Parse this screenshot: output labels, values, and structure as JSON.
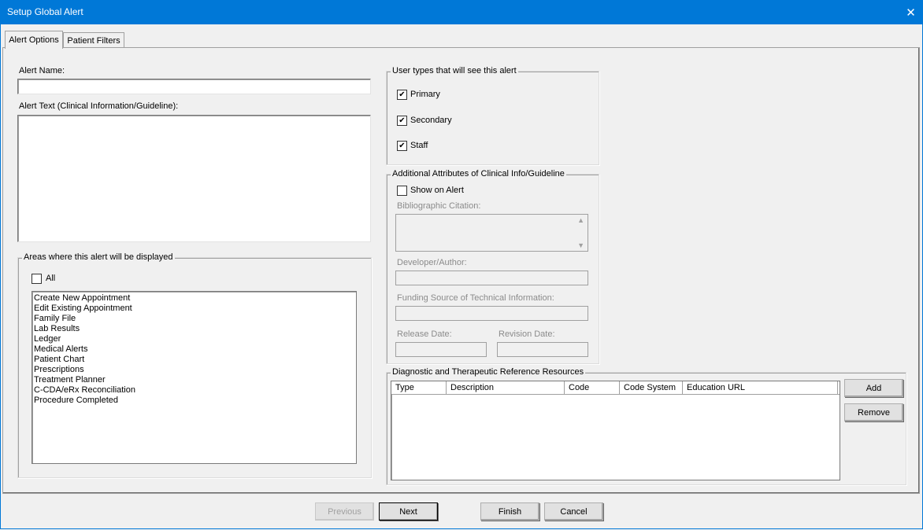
{
  "window": {
    "title": "Setup Global Alert",
    "close_glyph": "✕"
  },
  "tabs": [
    {
      "label": "Alert Options"
    },
    {
      "label": "Patient Filters"
    }
  ],
  "alert_name": {
    "label": "Alert Name:",
    "value": ""
  },
  "alert_text": {
    "label": "Alert Text (Clinical Information/Guideline):",
    "value": ""
  },
  "areas": {
    "caption": "Areas where this alert will be displayed",
    "all_label": "All",
    "all_checked": false,
    "items": [
      "Create New Appointment",
      "Edit Existing Appointment",
      "Family File",
      "Lab Results",
      "Ledger",
      "Medical Alerts",
      "Patient Chart",
      "Prescriptions",
      "Treatment Planner",
      "C-CDA/eRx Reconciliation",
      "Procedure Completed"
    ]
  },
  "user_types": {
    "caption": "User types that will see this alert",
    "options": [
      {
        "label": "Primary",
        "checked": true
      },
      {
        "label": "Secondary",
        "checked": true
      },
      {
        "label": "Staff",
        "checked": true
      }
    ],
    "check_glyph": "✔"
  },
  "attributes": {
    "caption": "Additional Attributes of Clinical Info/Guideline",
    "show_on_alert": "Show on Alert",
    "bibliographic": "Bibliographic Citation:",
    "developer": "Developer/Author:",
    "funding": "Funding Source of Technical Information:",
    "release_date": "Release Date:",
    "revision_date": "Revision Date:"
  },
  "resources": {
    "caption": "Diagnostic and Therapeutic Reference Resources",
    "columns": [
      "Type",
      "Description",
      "Code",
      "Code System",
      "Education URL"
    ],
    "add_label": "Add",
    "remove_label": "Remove"
  },
  "footer": {
    "previous": "Previous",
    "next": "Next",
    "finish": "Finish",
    "cancel": "Cancel"
  },
  "colors": {
    "titlebar": "#0078d7",
    "dialog_bg": "#f0f0f0"
  }
}
